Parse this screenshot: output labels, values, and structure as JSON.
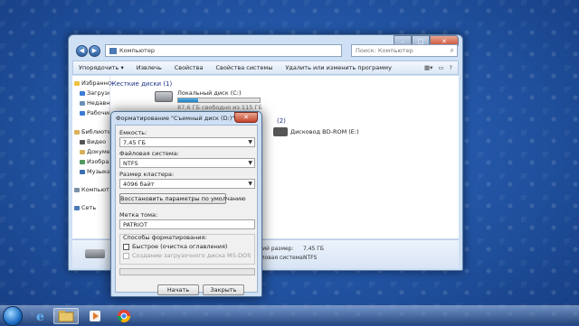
{
  "explorer": {
    "address": "Компьютер",
    "search_placeholder": "Поиск: Компьютер",
    "toolbar": [
      "Упорядочить ▾",
      "Извлечь",
      "Свойства",
      "Свойства системы",
      "Удалить или изменить программу"
    ],
    "nav": [
      {
        "label": "Избранное",
        "color": "#f0c040"
      },
      {
        "label": "Загрузки",
        "color": "#3a7bd5"
      },
      {
        "label": "Недавние места",
        "color": "#6b8fb5"
      },
      {
        "label": "Рабочий стол",
        "color": "#3a7bd5"
      },
      {
        "label": "Библиотеки",
        "color": "#d9b15a"
      },
      {
        "label": "Видео",
        "color": "#555"
      },
      {
        "label": "Документы",
        "color": "#d9b15a"
      },
      {
        "label": "Изображения",
        "color": "#4f9a5f"
      },
      {
        "label": "Музыка",
        "color": "#3a6fb5"
      },
      {
        "label": "Компьютер",
        "color": "#7a8fa8"
      },
      {
        "label": "Сеть",
        "color": "#4a79b5"
      }
    ],
    "group_hdd": "Жесткие диски (1)",
    "disk_c_name": "Локальный диск (C:)",
    "disk_c_free": "87,6 ГБ свободно из 115 ГБ",
    "disk_c_used_fraction": 0.24,
    "group_removable": "(2)",
    "bd_drive": "Дисковод BD-ROM (E:)",
    "details": {
      "total_label": "Общий размер:",
      "total_value": "7,45 ГБ",
      "fs_label": "Файловая система:",
      "fs_value": "NTFS"
    }
  },
  "format_dialog": {
    "title": "Форматирование \"Съемный диск (D:)\"",
    "capacity_label": "Емкость:",
    "capacity_value": "7,45 ГБ",
    "fs_label": "Файловая система:",
    "fs_value": "NTFS",
    "cluster_label": "Размер кластера:",
    "cluster_value": "4096 байт",
    "restore_button": "Восстановить параметры по умолчанию",
    "volume_label": "Метка тома:",
    "volume_value": "PATRIOT",
    "methods_label": "Способы форматирования:",
    "quick_format": "Быстрое (очистка оглавления)",
    "msdos_disk": "Создание загрузочного диска MS-DOS",
    "start_button": "Начать",
    "close_button": "Закрыть"
  }
}
